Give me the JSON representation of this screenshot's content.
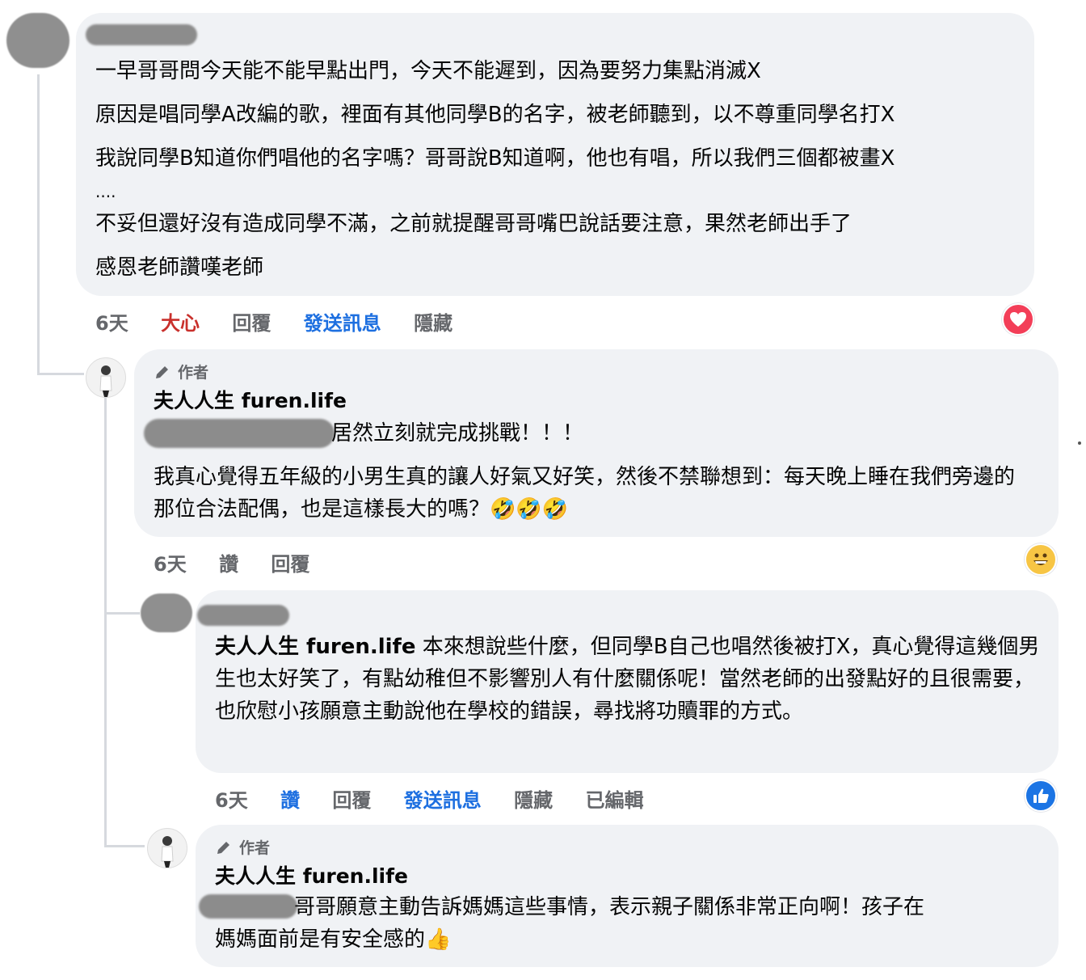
{
  "comment1": {
    "lines": [
      "一早哥哥問今天能不能早點出門，今天不能遲到，因為要努力集點消滅X",
      "原因是唱同學A改編的歌，裡面有其他同學B的名字，被老師聽到，以不尊重同學名打X",
      "我說同學B知道你們唱他的名字嗎？哥哥說B知道啊，他也有唱，所以我們三個都被畫X",
      "....",
      "不妥但還好沒有造成同學不滿，之前就提醒哥哥嘴巴說話要注意，果然老師出手了",
      "感恩老師讚嘆老師"
    ],
    "time": "6天",
    "reaction": "大心",
    "reply": "回覆",
    "message": "發送訊息",
    "hide": "隱藏",
    "reaction_icon": "heart-icon"
  },
  "reply1": {
    "author_tag": "作者",
    "name": "夫人人生 furen.life",
    "line1": "居然立刻就完成挑戰！！！",
    "para": "我真心覺得五年級的小男生真的讓人好氣又好笑，然後不禁聯想到：每天晚上睡在我們旁邊的那位合法配偶，也是這樣長大的嗎？",
    "emoji": "🤣🤣🤣",
    "time": "6天",
    "like": "讚",
    "reply": "回覆",
    "reaction_icon": "grin-emoji-icon"
  },
  "reply2": {
    "mention": "夫人人生 furen.life",
    "text": " 本來想說些什麼，但同學B自己也唱然後被打X，真心覺得這幾個男生也太好笑了，有點幼稚但不影響別人有什麼關係呢！當然老師的出發點好的且很需要，也欣慰小孩願意主動說他在學校的錯誤，尋找將功贖罪的方式。",
    "time": "6天",
    "like": "讚",
    "reply": "回覆",
    "message": "發送訊息",
    "hide": "隱藏",
    "edited": "已編輯",
    "reaction_icon": "like-thumb-icon"
  },
  "reply3": {
    "author_tag": "作者",
    "name": "夫人人生 furen.life",
    "line1": "哥哥願意主動告訴媽媽這些事情，表示親子關係非常正向啊！孩子在",
    "line2": "媽媽面前是有安全感的",
    "emoji": "👍"
  },
  "colors": {
    "bubble": "#f0f2f5",
    "meta_gray": "#65676b",
    "love_red": "#c9302c",
    "link_blue": "#1d6fe0",
    "like_blue": "#1b74e4"
  }
}
